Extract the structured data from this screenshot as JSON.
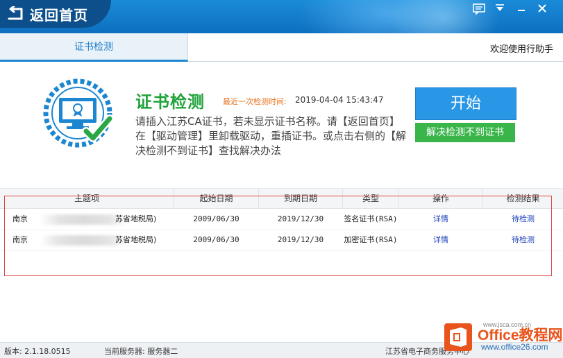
{
  "titlebar": {
    "back_label": "返回首页"
  },
  "tabs": {
    "active": "证书检测",
    "welcome": "欢迎使用行助手"
  },
  "detect": {
    "title": "证书检测",
    "last_check_label": "最近一次检测时间:",
    "last_check_value": "2019-04-04 15:43:47",
    "description": "请插入江苏CA证书，若未显示证书名称。请【返回首页】在【驱动管理】里卸载驱动，重插证书。或点击右侧的【解决检测不到证书】查找解决办法",
    "start_button": "开始",
    "solve_button": "解决检测不到证书"
  },
  "table": {
    "headers": [
      "主题项",
      "起始日期",
      "到期日期",
      "类型",
      "操作",
      "检测结果"
    ],
    "rows": [
      {
        "subject_prefix": "南京",
        "subject_suffix": "苏省地税局)",
        "start": "2009/06/30",
        "end": "2019/12/30",
        "type": "签名证书(RSA)",
        "action": "详情",
        "result": "待检测"
      },
      {
        "subject_prefix": "南京",
        "subject_suffix": "苏省地税局)",
        "start": "2009/06/30",
        "end": "2019/12/30",
        "type": "加密证书(RSA)",
        "action": "详情",
        "result": "待检测"
      }
    ]
  },
  "status": {
    "version": "版本: 2.1.18.0515",
    "server": "当前服务器: 服务器二",
    "org": "江苏省电子商务服务中心"
  },
  "watermark": {
    "brand": "Office教程网",
    "url": "www.office26.com",
    "small_url": "www.jsca.com.cn"
  },
  "colors": {
    "titlebar": "#1a8bd8",
    "accent_blue": "#2a97e6",
    "accent_green": "#39b54a",
    "title_green": "#21a33b",
    "orange": "#e8711c",
    "highlight_red": "#e04545"
  },
  "icons": [
    "back-arrow-icon",
    "message-icon",
    "dropdown-icon",
    "minimize-icon",
    "close-icon",
    "certificate-monitor-icon"
  ]
}
